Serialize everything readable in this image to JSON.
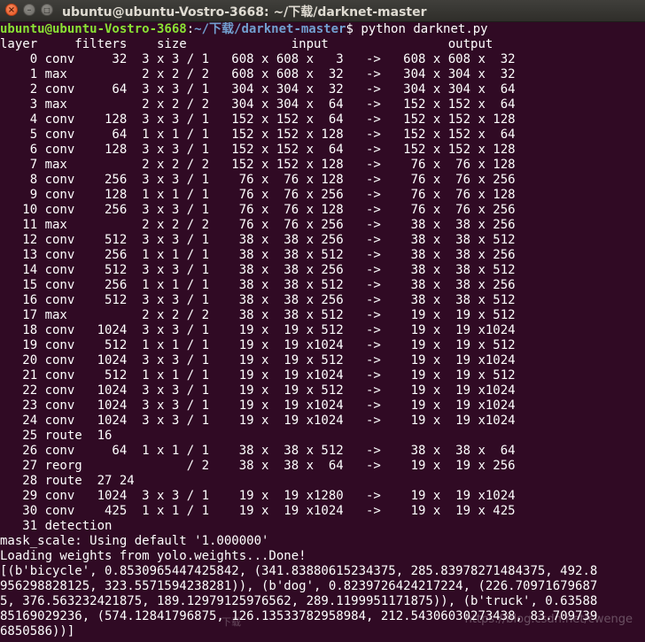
{
  "window": {
    "title": "ubuntu@ubuntu-Vostro-3668: ~/下载/darknet-master",
    "close_glyph": "×",
    "minimize_glyph": "–",
    "maximize_glyph": "□"
  },
  "prompt": {
    "user_host": "ubuntu@ubuntu-Vostro-3668",
    "colon": ":",
    "path": "~/下载/darknet-master",
    "dollar": "$ ",
    "command": "python darknet.py"
  },
  "output_lines": [
    "layer     filters    size              input                output",
    "    0 conv     32  3 x 3 / 1   608 x 608 x   3   ->   608 x 608 x  32",
    "    1 max          2 x 2 / 2   608 x 608 x  32   ->   304 x 304 x  32",
    "    2 conv     64  3 x 3 / 1   304 x 304 x  32   ->   304 x 304 x  64",
    "    3 max          2 x 2 / 2   304 x 304 x  64   ->   152 x 152 x  64",
    "    4 conv    128  3 x 3 / 1   152 x 152 x  64   ->   152 x 152 x 128",
    "    5 conv     64  1 x 1 / 1   152 x 152 x 128   ->   152 x 152 x  64",
    "    6 conv    128  3 x 3 / 1   152 x 152 x  64   ->   152 x 152 x 128",
    "    7 max          2 x 2 / 2   152 x 152 x 128   ->    76 x  76 x 128",
    "    8 conv    256  3 x 3 / 1    76 x  76 x 128   ->    76 x  76 x 256",
    "    9 conv    128  1 x 1 / 1    76 x  76 x 256   ->    76 x  76 x 128",
    "   10 conv    256  3 x 3 / 1    76 x  76 x 128   ->    76 x  76 x 256",
    "   11 max          2 x 2 / 2    76 x  76 x 256   ->    38 x  38 x 256",
    "   12 conv    512  3 x 3 / 1    38 x  38 x 256   ->    38 x  38 x 512",
    "   13 conv    256  1 x 1 / 1    38 x  38 x 512   ->    38 x  38 x 256",
    "   14 conv    512  3 x 3 / 1    38 x  38 x 256   ->    38 x  38 x 512",
    "   15 conv    256  1 x 1 / 1    38 x  38 x 512   ->    38 x  38 x 256",
    "   16 conv    512  3 x 3 / 1    38 x  38 x 256   ->    38 x  38 x 512",
    "   17 max          2 x 2 / 2    38 x  38 x 512   ->    19 x  19 x 512",
    "   18 conv   1024  3 x 3 / 1    19 x  19 x 512   ->    19 x  19 x1024",
    "   19 conv    512  1 x 1 / 1    19 x  19 x1024   ->    19 x  19 x 512",
    "   20 conv   1024  3 x 3 / 1    19 x  19 x 512   ->    19 x  19 x1024",
    "   21 conv    512  1 x 1 / 1    19 x  19 x1024   ->    19 x  19 x 512",
    "   22 conv   1024  3 x 3 / 1    19 x  19 x 512   ->    19 x  19 x1024",
    "   23 conv   1024  3 x 3 / 1    19 x  19 x1024   ->    19 x  19 x1024",
    "   24 conv   1024  3 x 3 / 1    19 x  19 x1024   ->    19 x  19 x1024",
    "   25 route  16",
    "   26 conv     64  1 x 1 / 1    38 x  38 x 512   ->    38 x  38 x  64",
    "   27 reorg              / 2    38 x  38 x  64   ->    19 x  19 x 256",
    "   28 route  27 24",
    "   29 conv   1024  3 x 3 / 1    19 x  19 x1280   ->    19 x  19 x1024",
    "   30 conv    425  1 x 1 / 1    19 x  19 x1024   ->    19 x  19 x 425",
    "   31 detection",
    "mask_scale: Using default '1.000000'",
    "Loading weights from yolo.weights...Done!",
    "[(b'bicycle', 0.8530965447425842, (341.83880615234375, 285.83978271484375, 492.8",
    "956298828125, 323.5571594238281)), (b'dog', 0.8239726424217224, (226.70971679687",
    "5, 376.563232421875, 189.12979125976562, 289.1199951171875)), (b'truck', 0.63588",
    "85169029236, (574.12841796875, 126.13533782958984, 212.54306030273438, 83.709739",
    "6850586))]"
  ],
  "watermark": "https://blog.csdn.net/cwenge",
  "faded_text": "下载",
  "colors": {
    "background": "#300a24",
    "prompt_user": "#8ae234",
    "prompt_path": "#729fcf",
    "text": "#ffffff"
  }
}
